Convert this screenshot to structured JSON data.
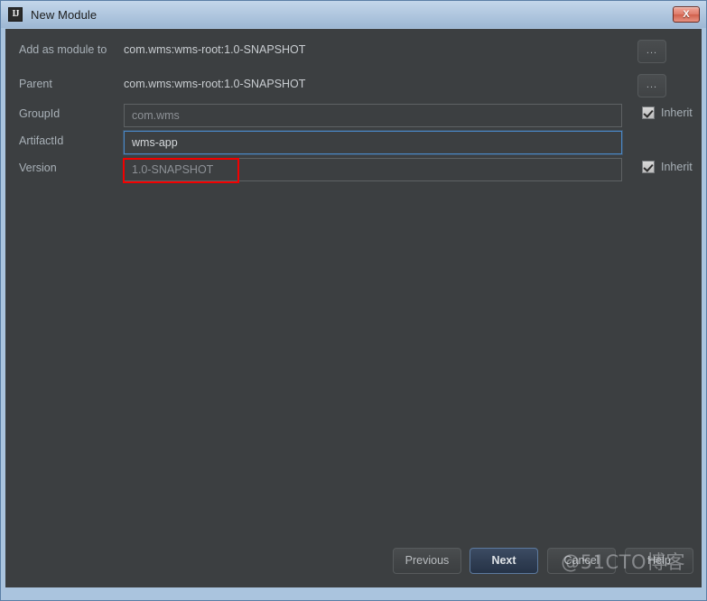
{
  "window": {
    "title": "New Module",
    "app_icon": "intellij-idea-icon",
    "close_label": "X",
    "frame_color": "#aac4de",
    "panel_color": "#3c3f41",
    "accent_focus_color": "#4a88c7",
    "annotation_color": "#f20000"
  },
  "form": {
    "rows": [
      {
        "label": "Add as module to",
        "kind": "static",
        "value": "com.wms:wms-root:1.0-SNAPSHOT",
        "browse_label": "...",
        "has_browse": true,
        "has_inherit": false
      },
      {
        "label": "Parent",
        "kind": "static",
        "value": "com.wms:wms-root:1.0-SNAPSHOT",
        "browse_label": "...",
        "has_browse": true,
        "has_inherit": false
      },
      {
        "label": "GroupId",
        "kind": "input",
        "value": "com.wms",
        "placeholder": "com.wms",
        "focused": false,
        "has_browse": false,
        "has_inherit": true,
        "inherit_label": "Inherit",
        "inherit_checked": true
      },
      {
        "label": "ArtifactId",
        "kind": "input",
        "value": "wms-app",
        "placeholder": "wms-app",
        "focused": true,
        "has_browse": false,
        "has_inherit": false
      },
      {
        "label": "Version",
        "kind": "input",
        "value": "1.0-SNAPSHOT",
        "placeholder": "1.0-SNAPSHOT",
        "focused": false,
        "has_browse": false,
        "has_inherit": true,
        "inherit_label": "Inherit",
        "inherit_checked": true
      }
    ]
  },
  "buttons": {
    "previous": "Previous",
    "next": "Next",
    "cancel": "Cancel",
    "help": "Help"
  },
  "watermark": {
    "text": "@51CTO博客"
  }
}
